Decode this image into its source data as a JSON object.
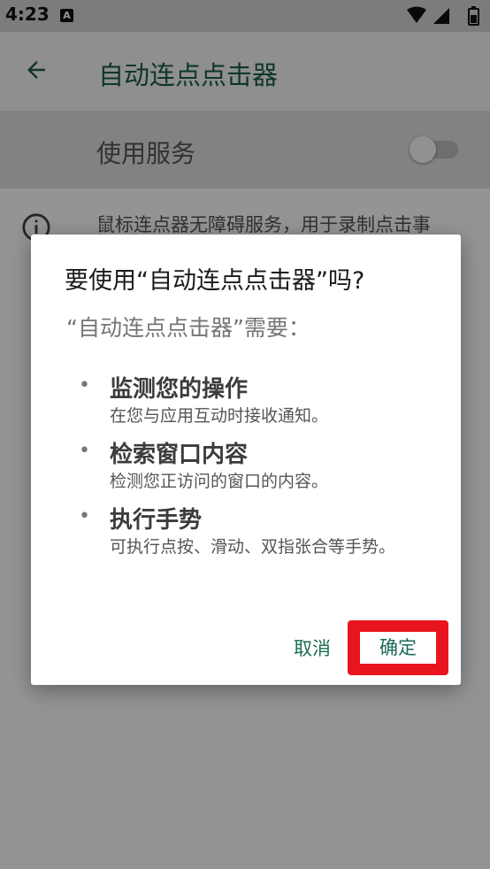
{
  "status_bar": {
    "time": "4:23",
    "notification_glyph": "A",
    "icons": [
      "wifi-icon",
      "cellular-signal-icon",
      "battery-icon"
    ]
  },
  "app_bar": {
    "title": "自动连点点击器",
    "back_icon": "arrow-back-icon"
  },
  "settings": {
    "service_label": "使用服务",
    "service_enabled": false,
    "info_text": "鼠标连点器无障碍服务，用于录制点击事"
  },
  "dialog": {
    "title": "要使用“自动连点点击器”吗?",
    "subtitle": "“自动连点点击器”需要：",
    "bullet": "•",
    "permissions": [
      {
        "title": "监测您的操作",
        "description": "在您与应用互动时接收通知。"
      },
      {
        "title": "检索窗口内容",
        "description": "检测您正访问的窗口的内容。"
      },
      {
        "title": "执行手势",
        "description": "可执行点按、滑动、双指张合等手势。"
      }
    ],
    "cancel_label": "取消",
    "confirm_label": "确定"
  },
  "colors": {
    "accent": "#1b6b57",
    "title_green": "#1b5e4c",
    "highlight_red": "#e8141e"
  }
}
